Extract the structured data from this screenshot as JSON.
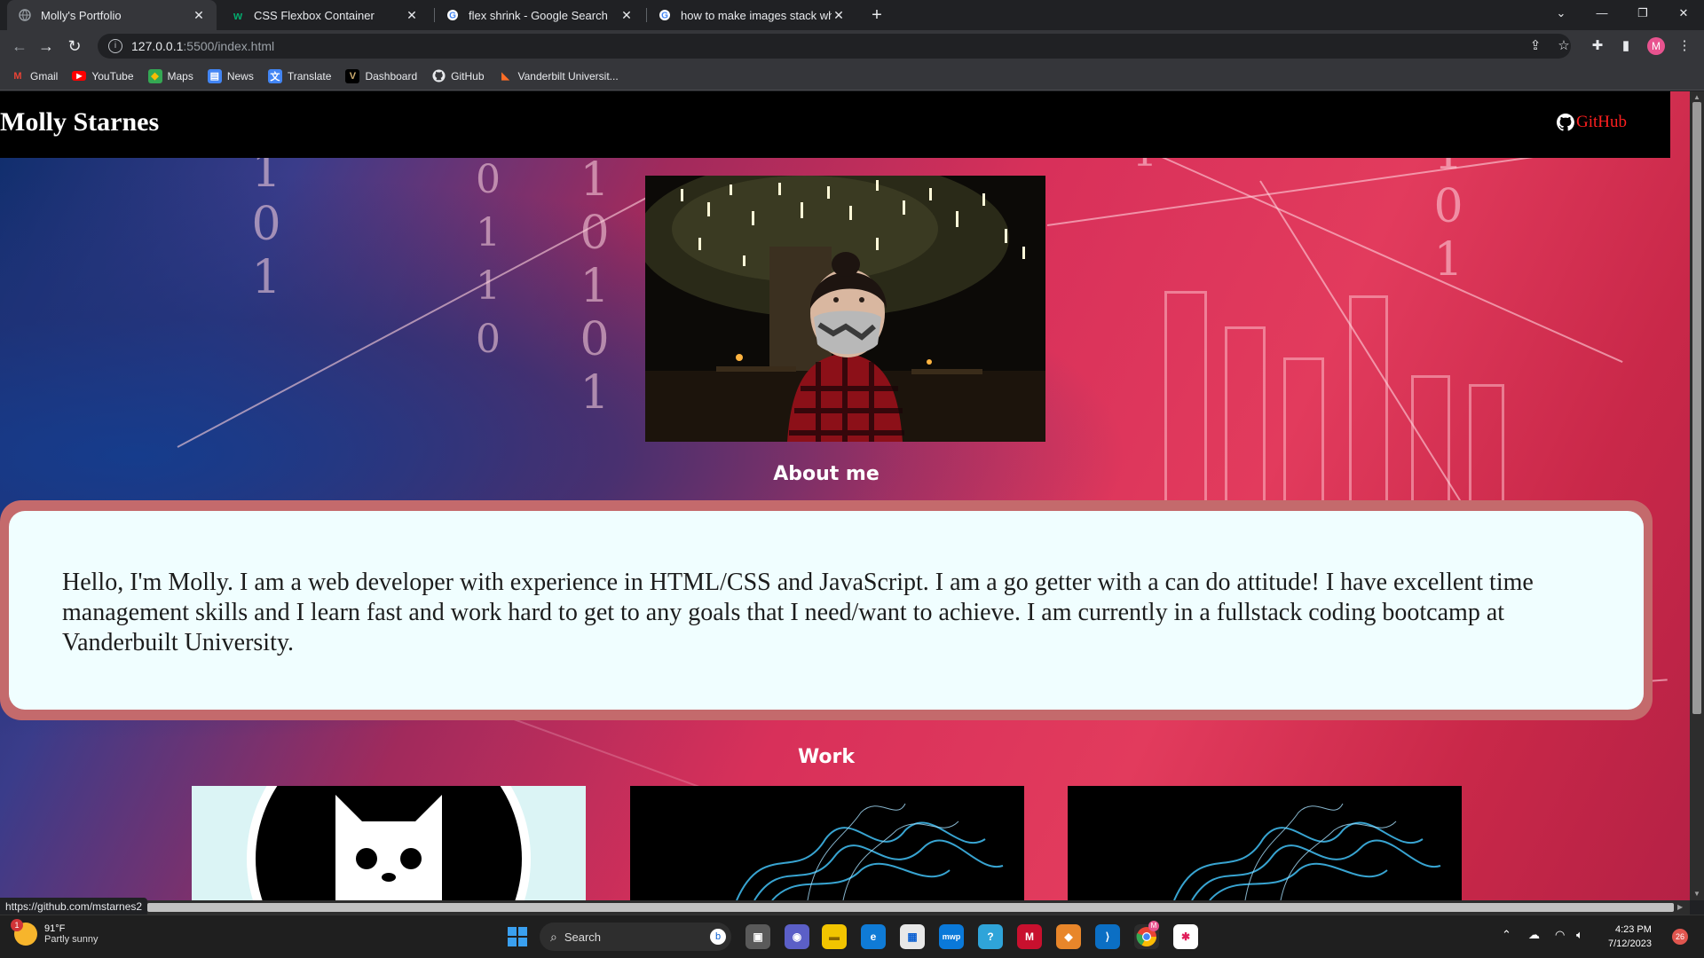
{
  "browser": {
    "tabs": [
      {
        "title": "Molly's Portfolio",
        "active": true,
        "icon": "globe-icon"
      },
      {
        "title": "CSS Flexbox Container",
        "active": false,
        "icon": "w3schools-icon"
      },
      {
        "title": "flex shrink - Google Search",
        "active": false,
        "icon": "google-icon"
      },
      {
        "title": "how to make images stack when",
        "active": false,
        "icon": "google-icon"
      }
    ],
    "url_host": "127.0.0.1",
    "url_rest": ":5500/index.html",
    "profile_initial": "M",
    "bookmarks": [
      {
        "label": "Gmail",
        "icon": "gmail-icon"
      },
      {
        "label": "YouTube",
        "icon": "youtube-icon"
      },
      {
        "label": "Maps",
        "icon": "maps-icon"
      },
      {
        "label": "News",
        "icon": "news-icon"
      },
      {
        "label": "Translate",
        "icon": "translate-icon"
      },
      {
        "label": "Dashboard",
        "icon": "vanderbilt-icon"
      },
      {
        "label": "GitHub",
        "icon": "github-icon"
      },
      {
        "label": "Vanderbilt Universit...",
        "icon": "gitlab-icon"
      }
    ],
    "status_url": "https://github.com/mstarnes2"
  },
  "site": {
    "title": "Molly Starnes",
    "github_label": "GitHub",
    "about_heading": "About me",
    "about_text": "Hello, I'm Molly. I am a web developer with experience in HTML/CSS and JavaScript. I am a go getter with a can do attitude! I have excellent time management skills and I learn fast and work hard to get to any goals that I need/want to achieve. I am currently in a fullstack coding bootcamp at Vanderbuilt University.",
    "work_heading": "Work",
    "background_digits": [
      "0",
      "1",
      "0",
      "1",
      "0",
      "1",
      "1",
      "0",
      "1",
      "0",
      "1",
      "0",
      "1"
    ]
  },
  "taskbar": {
    "weather_badge": "1",
    "weather_temp": "91°F",
    "weather_desc": "Partly sunny",
    "search_label": "Search",
    "chrome_badge": "M",
    "time": "4:23 PM",
    "date": "7/12/2023",
    "notification_count": "26"
  },
  "colors": {
    "accent_link": "#ff1f1f",
    "about_border": "#c46a6c",
    "about_bg": "#f0feff",
    "header_bg": "#000000"
  }
}
